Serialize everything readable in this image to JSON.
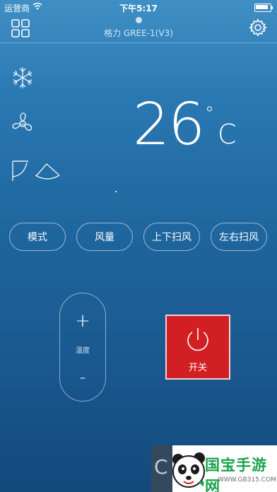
{
  "status_bar": {
    "carrier": "运营商",
    "time": "下午5:17"
  },
  "header": {
    "title": "格力 GREE-1(V3)"
  },
  "display": {
    "temperature": "26",
    "degree_symbol": "°",
    "unit": "C"
  },
  "function_buttons": [
    "模式",
    "风量",
    "上下扫风",
    "左右扫风"
  ],
  "temp_control": {
    "plus": "+",
    "label": "温度",
    "minus": "-"
  },
  "power": {
    "label": "开关"
  },
  "ad": {
    "tile_letter": "C",
    "brand": "国宝手游网",
    "url": "WWW.GB315.COM"
  },
  "colors": {
    "accent_power": "#d11f24",
    "background_top": "#3f8fc4",
    "background_bottom": "#14497c",
    "ad_brand": "#1aa34a"
  }
}
